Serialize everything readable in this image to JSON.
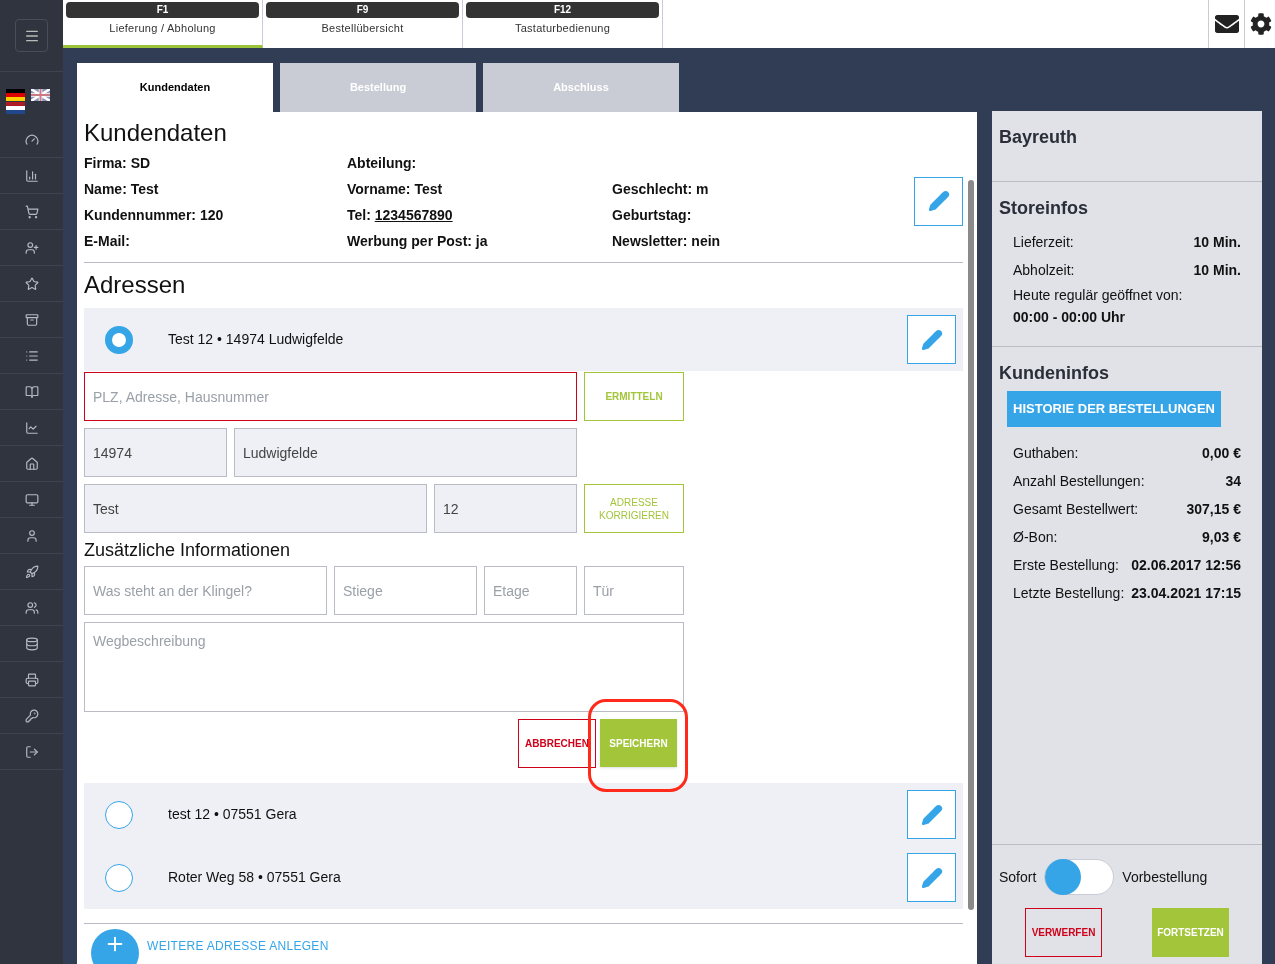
{
  "function_tabs": [
    {
      "key": "F1",
      "label": "Lieferung / Abholung",
      "selected": true
    },
    {
      "key": "F9",
      "label": "Bestellübersicht",
      "selected": false
    },
    {
      "key": "F12",
      "label": "Tastaturbedienung",
      "selected": false
    }
  ],
  "step_tabs": [
    {
      "label": "Kundendaten",
      "selected": true
    },
    {
      "label": "Bestellung",
      "selected": false
    },
    {
      "label": "Abschluss",
      "selected": false
    }
  ],
  "customer": {
    "title": "Kundendaten",
    "rows": [
      [
        {
          "label": "Firma:",
          "value": "SD"
        },
        {
          "label": "Abteilung:"
        }
      ],
      [
        {
          "label": "Name:",
          "value": "Test"
        },
        {
          "label": "Vorname:",
          "value": "Test"
        },
        {
          "label": "Geschlecht:",
          "value": "m"
        }
      ],
      [
        {
          "label": "Kundennummer:",
          "value": "120"
        },
        {
          "label": "Tel:",
          "value": "1234567890",
          "kind": "link"
        },
        {
          "label": "Geburtstag:"
        }
      ],
      [
        {
          "label": "E-Mail:"
        },
        {
          "label": "Werbung per Post:",
          "value": "ja"
        },
        {
          "label": "Newsletter:",
          "value": "nein"
        }
      ]
    ]
  },
  "addresses": {
    "title": "Adressen",
    "items": [
      {
        "text": "Test 12 • 14974 Ludwigfelde",
        "selected": true
      },
      {
        "text": "test 12 • 07551 Gera",
        "selected": false
      },
      {
        "text": "Roter Weg 58 • 07551 Gera",
        "selected": false
      }
    ],
    "form": {
      "search_placeholder": "PLZ, Adresse, Hausnummer",
      "search_button": "ERMITTELN",
      "zip": "14974",
      "city": "Ludwigfelde",
      "street": "Test",
      "number": "12",
      "correct_button": "ADRESSE KORRIGIEREN",
      "extra_title": "Zusätzliche Informationen",
      "bell_placeholder": "Was steht an der Klingel?",
      "stair_placeholder": "Stiege",
      "floor_placeholder": "Etage",
      "door_placeholder": "Tür",
      "directions_placeholder": "Wegbeschreibung",
      "cancel_button": "ABBRECHEN",
      "save_button": "SPEICHERN"
    },
    "add_link": "WEITERE ADRESSE ANLEGEN"
  },
  "store": {
    "name": "Bayreuth",
    "title": "Storeinfos",
    "rows": [
      {
        "label": "Lieferzeit:",
        "value": "10 Min."
      },
      {
        "label": "Abholzeit:",
        "value": "10 Min."
      }
    ],
    "hours_label": "Heute regulär geöffnet von:",
    "hours": "00:00 - 00:00 Uhr"
  },
  "customer_info": {
    "title": "Kundeninfos",
    "history_button": "HISTORIE DER BESTELLUNGEN",
    "rows": [
      {
        "label": "Guthaben:",
        "value": "0,00 €"
      },
      {
        "label": "Anzahl Bestellungen:",
        "value": "34"
      },
      {
        "label": "Gesamt Bestellwert:",
        "value": "307,15 €"
      },
      {
        "label": "Ø-Bon:",
        "value": "9,03 €"
      },
      {
        "label": "Erste Bestellung:",
        "value": "02.06.2017 12:56"
      },
      {
        "label": "Letzte Bestellung:",
        "value": "23.04.2021 17:15"
      }
    ]
  },
  "order_mode": {
    "left": "Sofort",
    "right": "Vorbestellung",
    "preorder": false
  },
  "actions": {
    "discard": "VERWERFEN",
    "continue": "FORTSETZEN"
  }
}
